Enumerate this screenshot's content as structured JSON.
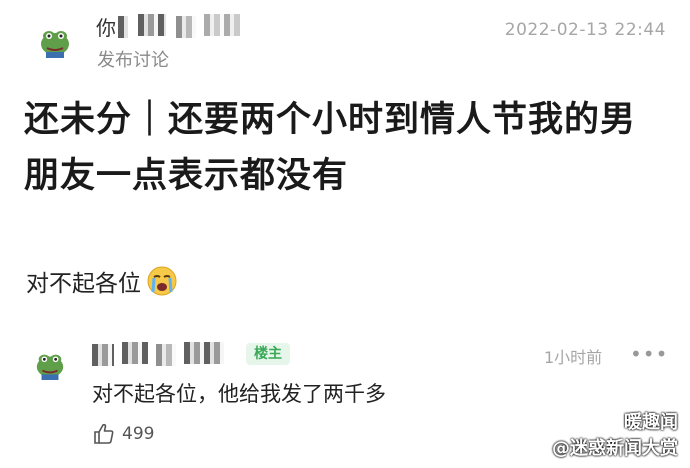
{
  "post": {
    "user_visible_char": "你",
    "subtitle": "发布讨论",
    "timestamp": "2022-02-13 22:44",
    "title": "还未分｜还要两个小时到情人节我的男朋友一点表示都没有",
    "body": "对不起各位",
    "body_emoji": "loudly-crying-face-icon"
  },
  "comment": {
    "badge": "楼主",
    "time": "1小时前",
    "more": "•••",
    "text": "对不起各位，他给我发了两千多",
    "likes": "499"
  },
  "watermark": {
    "line1": "暖趣闻",
    "line2": "@迷惑新闻大赏"
  },
  "colors": {
    "badge_bg": "#e6f6ea",
    "badge_fg": "#3aa857",
    "muted": "#a6a6a6"
  }
}
